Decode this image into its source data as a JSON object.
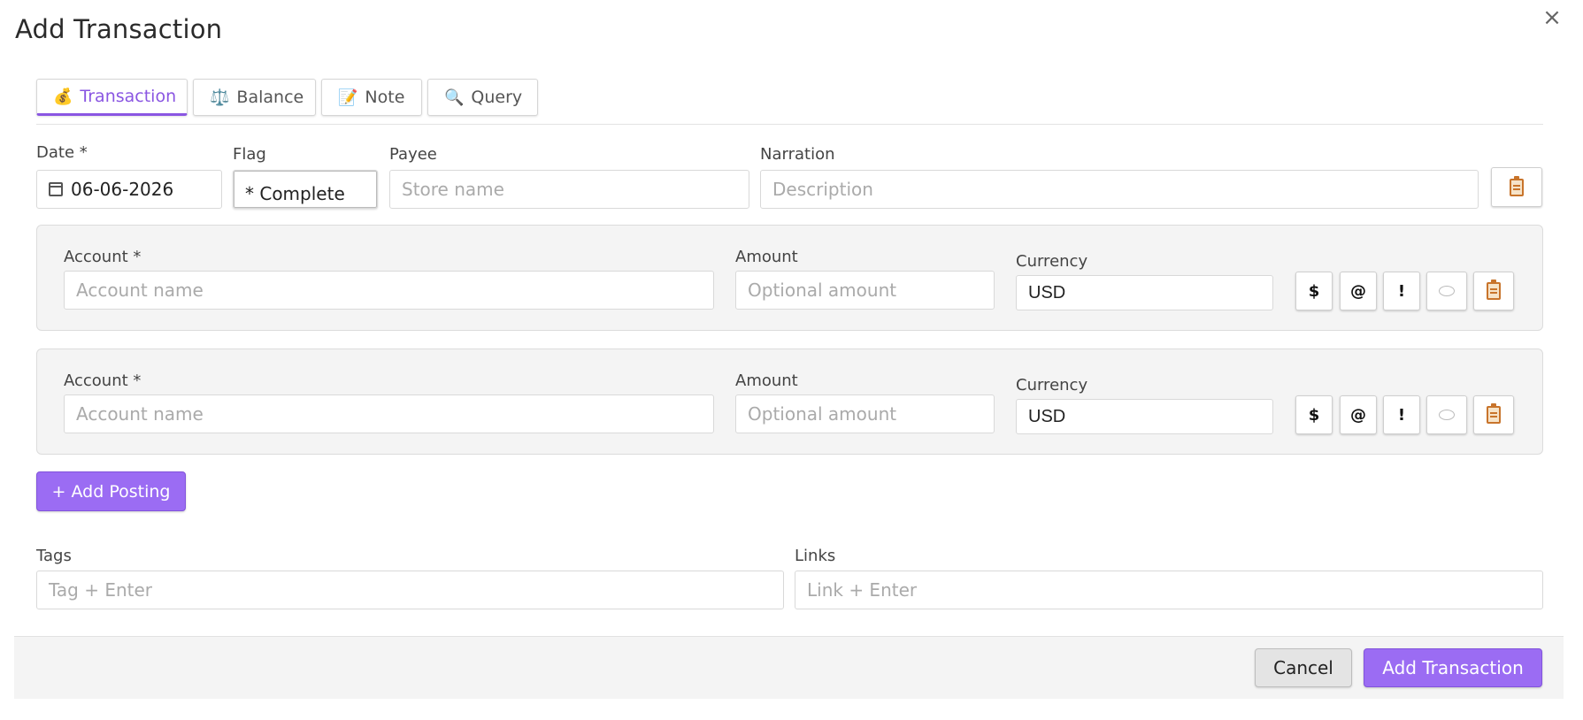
{
  "dialog": {
    "title": "Add Transaction",
    "close_symbol": "×"
  },
  "tabs": [
    {
      "label": "Transaction",
      "emoji": "💰",
      "active": true
    },
    {
      "label": "Balance",
      "emoji": "⚖️",
      "active": false
    },
    {
      "label": "Note",
      "emoji": "📝",
      "active": false
    },
    {
      "label": "Query",
      "emoji": "🔍",
      "active": false
    }
  ],
  "header_fields": {
    "date": {
      "label": "Date *",
      "value": "06-06-2026",
      "icon": "calendar-icon"
    },
    "flag": {
      "label": "Flag",
      "value": "* Complete"
    },
    "payee": {
      "label": "Payee",
      "placeholder": "Store name"
    },
    "narration": {
      "label": "Narration",
      "placeholder": "Description"
    },
    "paste_icon": "clipboard-icon"
  },
  "postings": [
    {
      "account_label": "Account *",
      "account_placeholder": "Account name",
      "amount_label": "Amount",
      "amount_placeholder": "Optional amount",
      "currency_label": "Currency",
      "currency_value": "USD",
      "buttons": [
        "$",
        "@",
        "!"
      ]
    },
    {
      "account_label": "Account *",
      "account_placeholder": "Account name",
      "amount_label": "Amount",
      "amount_placeholder": "Optional amount",
      "currency_label": "Currency",
      "currency_value": "USD",
      "buttons": [
        "$",
        "@",
        "!"
      ]
    }
  ],
  "add_posting_label": "+ Add Posting",
  "tags": {
    "label": "Tags",
    "placeholder": "Tag + Enter"
  },
  "links": {
    "label": "Links",
    "placeholder": "Link + Enter"
  },
  "footer": {
    "cancel_label": "Cancel",
    "submit_label": "Add Transaction"
  },
  "colors": {
    "accent": "#9b6cf3",
    "panel_bg": "#f4f4f4"
  }
}
